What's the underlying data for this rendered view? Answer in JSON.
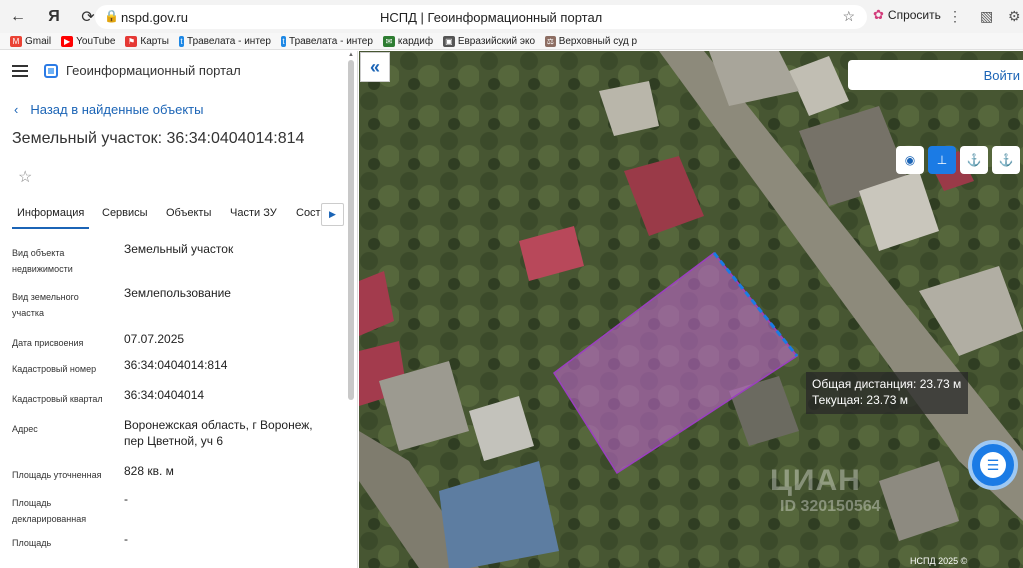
{
  "browser": {
    "url": "nspd.gov.ru",
    "tab_title": "НСПД | Геоинформационный портал",
    "ask_label": "Спросить",
    "bookmarks": [
      {
        "label": "Gmail",
        "color": "#ea4335",
        "glyph": "M"
      },
      {
        "label": "YouTube",
        "color": "#ff0000",
        "glyph": "▶"
      },
      {
        "label": "Карты",
        "color": "#e53935",
        "glyph": "⚑"
      },
      {
        "label": "Травелата - интер",
        "color": "#1e88e5",
        "glyph": "t"
      },
      {
        "label": "Травелата - интер",
        "color": "#1e88e5",
        "glyph": "t"
      },
      {
        "label": "кардиф",
        "color": "#2e7d32",
        "glyph": "✉"
      },
      {
        "label": "Евразийский эко",
        "color": "#555555",
        "glyph": "▣"
      },
      {
        "label": "Верховный суд р",
        "color": "#8d6e63",
        "glyph": "⚖"
      }
    ]
  },
  "panel": {
    "portal_title": "Геоинформационный портал",
    "back_label": "Назад в найденные объекты",
    "object_title": "Земельный участок: 36:34:0404014:814",
    "tabs": [
      "Информация",
      "Сервисы",
      "Объекты",
      "Части ЗУ",
      "Соста"
    ],
    "attributes": [
      {
        "key": "Вид объекта недвижимости",
        "value": "Земельный участок"
      },
      {
        "key": "Вид земельного участка",
        "value": "Землепользование"
      },
      {
        "key": "Дата присвоения",
        "value": "07.07.2025"
      },
      {
        "key": "Кадастровый номер",
        "value": "36:34:0404014:814"
      },
      {
        "key": "Кадастровый квартал",
        "value": "36:34:0404014"
      },
      {
        "key": "Адрес",
        "value": "Воронежская область, г Воронеж, пер Цветной, уч 6"
      },
      {
        "key": "Площадь уточненная",
        "value": "828 кв. м"
      },
      {
        "key": "Площадь декларированная",
        "value": "-"
      },
      {
        "key": "Площадь",
        "value": "-"
      }
    ]
  },
  "map": {
    "login_label": "Войти",
    "measure_total": "Общая дистанция: 23.73 м",
    "measure_current": "Текущая: 23.73 м",
    "copyright": "НСПД 2025 ©",
    "watermark": "ЦИАН",
    "watermark_id": "ID 320150564",
    "colors": {
      "parcel": "#c86ad8",
      "accent": "#1b7be5"
    }
  }
}
